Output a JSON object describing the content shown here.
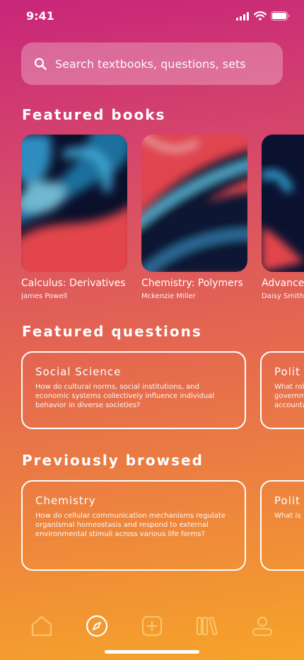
{
  "status_bar": {
    "time": "9:41"
  },
  "search": {
    "placeholder": "Search textbooks, questions, sets"
  },
  "sections": {
    "featured_books": "Featured books",
    "featured_questions": "Featured questions",
    "previously_browsed": "Previously browsed"
  },
  "books": [
    {
      "title": "Calculus: Derivatives",
      "author": "James Powell"
    },
    {
      "title": "Chemistry: Polymers",
      "author": "Mckenzie Miller"
    },
    {
      "title": "Advance",
      "author": "Daisy Smith"
    }
  ],
  "featured_questions": [
    {
      "subject": "Social Science",
      "text": "How do cultural norms, social institutions, and economic systems collectively influence individual behavior in diverse societies?"
    },
    {
      "subject": "Polit",
      "text": "What rol\ngovernm\naccounta"
    }
  ],
  "previously_browsed": [
    {
      "subject": "Chemistry",
      "text": "How do cellular communication mechanisms regulate organismal homeostasis and respond to external environmental stimuli across various life forms?"
    },
    {
      "subject": "Polit",
      "text": "What is"
    }
  ],
  "tabbar": {
    "icons": [
      "home-icon",
      "compass-icon",
      "add-icon",
      "library-icon",
      "profile-icon"
    ],
    "active_index": 1
  }
}
